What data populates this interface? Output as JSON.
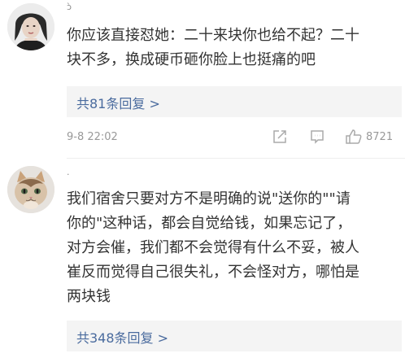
{
  "comments": [
    {
      "username": "ɔ̀",
      "text_line1": "你应该直接怼她：二十来块你也给不起？二十",
      "text_line2": "块不多，换成硬币砸你脸上也挺痛的吧",
      "replies_label": "共81条回复 >",
      "timestamp": "9-8 22:02",
      "like_count": "8721",
      "icons": [
        "share-icon",
        "comment-icon",
        "like-icon"
      ]
    },
    {
      "username": "·",
      "text_line1": "我们宿舍只要对方不是明确的说\"送你的\"\"请",
      "text_line2": "你的\"这种话，都会自觉给钱，如果忘记了，",
      "text_line3": "对方会催，我们都不会觉得有什么不妥，被人",
      "text_line4": "崔反而觉得自己很失礼，不会怪对方，哪怕是",
      "text_line5": "两块钱",
      "replies_label": "共348条回复 >"
    }
  ],
  "colors": {
    "link": "#4a6b9e",
    "meta": "#999999",
    "reply_bg": "#f4f4f4"
  }
}
